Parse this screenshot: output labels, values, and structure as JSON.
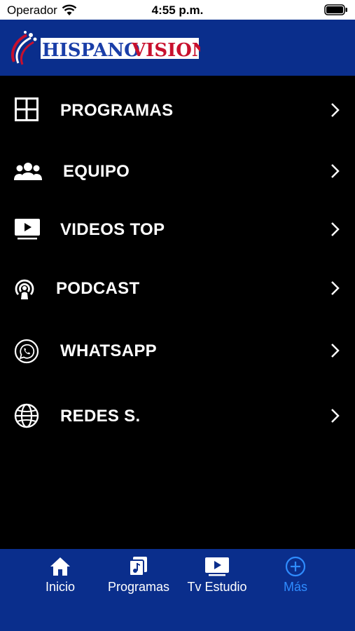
{
  "status_bar": {
    "carrier": "Operador",
    "time": "4:55 p.m."
  },
  "header": {
    "logo_text_hispano": "HISPANO",
    "logo_text_vision": "VISION"
  },
  "menu": {
    "items": [
      {
        "label": "PROGRAMAS",
        "icon": "grid-icon"
      },
      {
        "label": "EQUIPO",
        "icon": "people-icon"
      },
      {
        "label": "VIDEOS TOP",
        "icon": "tv-play-icon"
      },
      {
        "label": "PODCAST",
        "icon": "podcast-icon"
      },
      {
        "label": "WHATSAPP",
        "icon": "whatsapp-icon"
      },
      {
        "label": "REDES S.",
        "icon": "globe-icon"
      }
    ]
  },
  "tab_bar": {
    "tabs": [
      {
        "label": "Inicio",
        "icon": "home-icon",
        "active": false
      },
      {
        "label": "Programas",
        "icon": "music-note-icon",
        "active": false
      },
      {
        "label": "Tv  Estudio",
        "icon": "tv-play-icon",
        "active": false
      },
      {
        "label": "Más",
        "icon": "plus-circle-icon",
        "active": true
      }
    ]
  },
  "colors": {
    "header_bg": "#0a2e8c",
    "menu_bg": "#000000",
    "active_tab": "#2f8cff"
  }
}
